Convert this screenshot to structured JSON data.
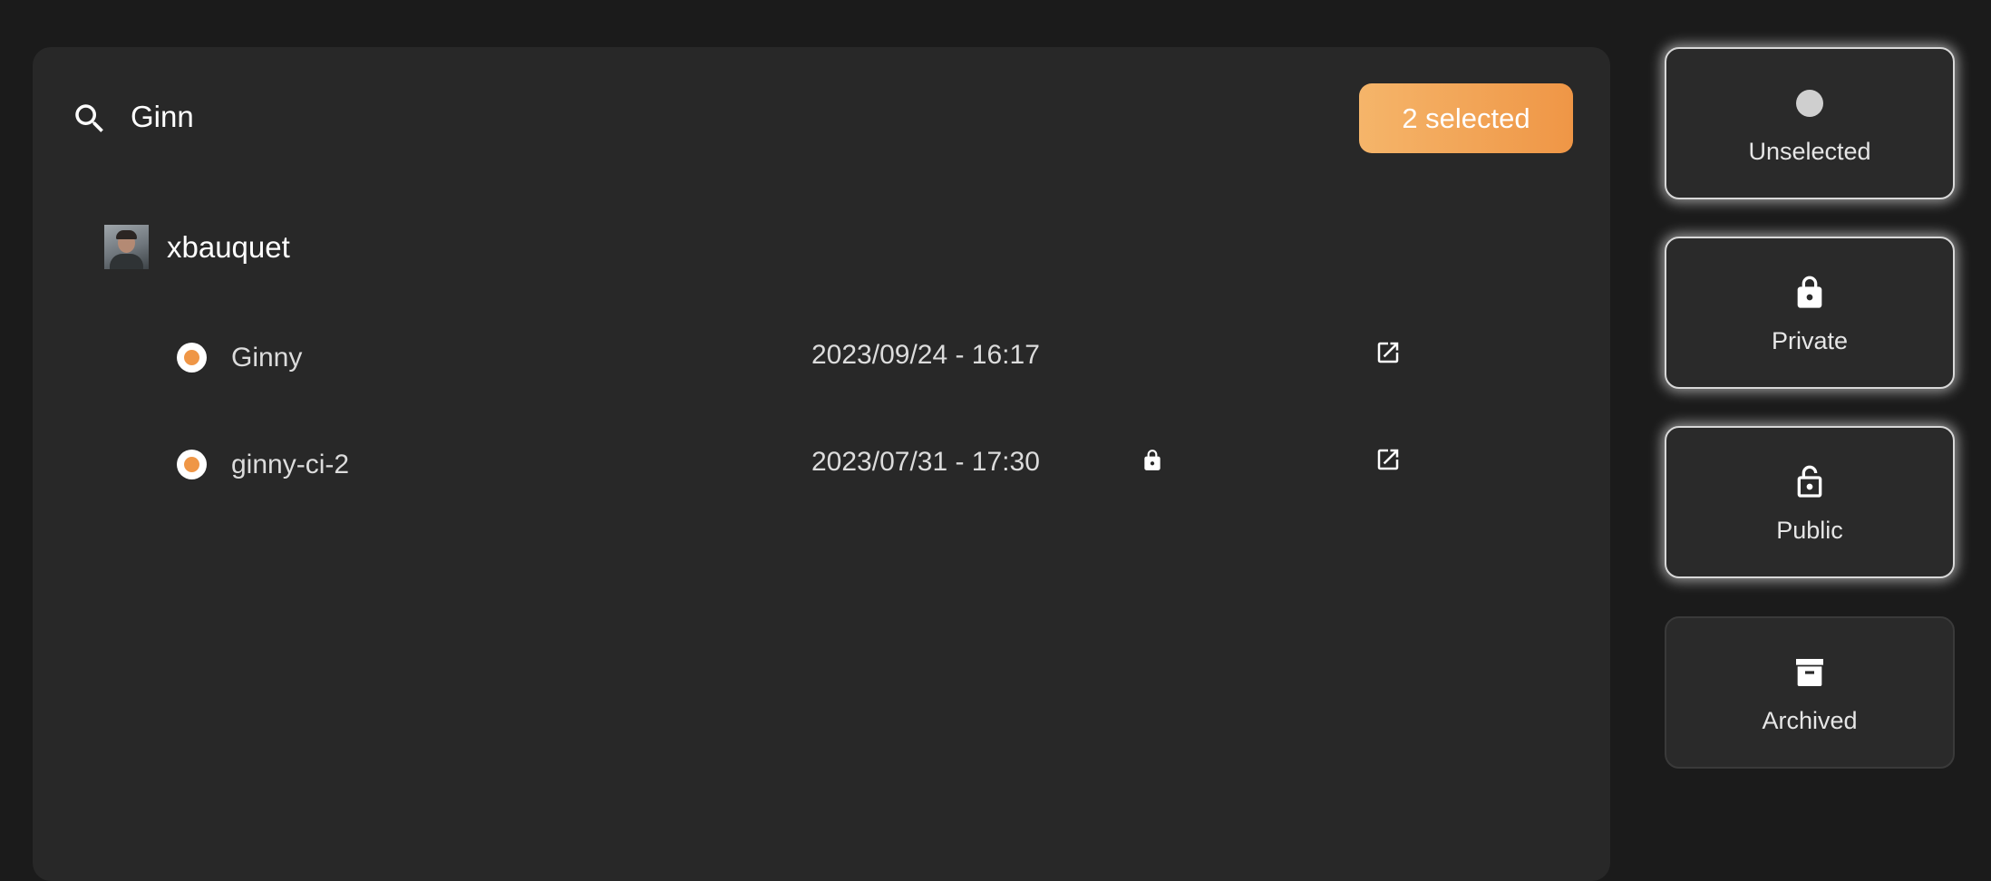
{
  "search": {
    "value": "Ginn",
    "placeholder": ""
  },
  "selection": {
    "label": "2 selected"
  },
  "owner": {
    "name": "xbauquet"
  },
  "repos": [
    {
      "name": "Ginny",
      "date": "2023/09/24 - 16:17",
      "locked": false
    },
    {
      "name": "ginny-ci-2",
      "date": "2023/07/31 - 17:30",
      "locked": true
    }
  ],
  "filters": [
    {
      "label": "Unselected",
      "icon": "circle-icon",
      "active": true
    },
    {
      "label": "Private",
      "icon": "lock-icon",
      "active": true
    },
    {
      "label": "Public",
      "icon": "lock-open-icon",
      "active": true
    },
    {
      "label": "Archived",
      "icon": "archive-icon",
      "active": false
    }
  ],
  "colors": {
    "background": "#1b1b1b",
    "panel": "#282828",
    "accent_start": "#f5b56a",
    "accent_end": "#ef9646"
  }
}
